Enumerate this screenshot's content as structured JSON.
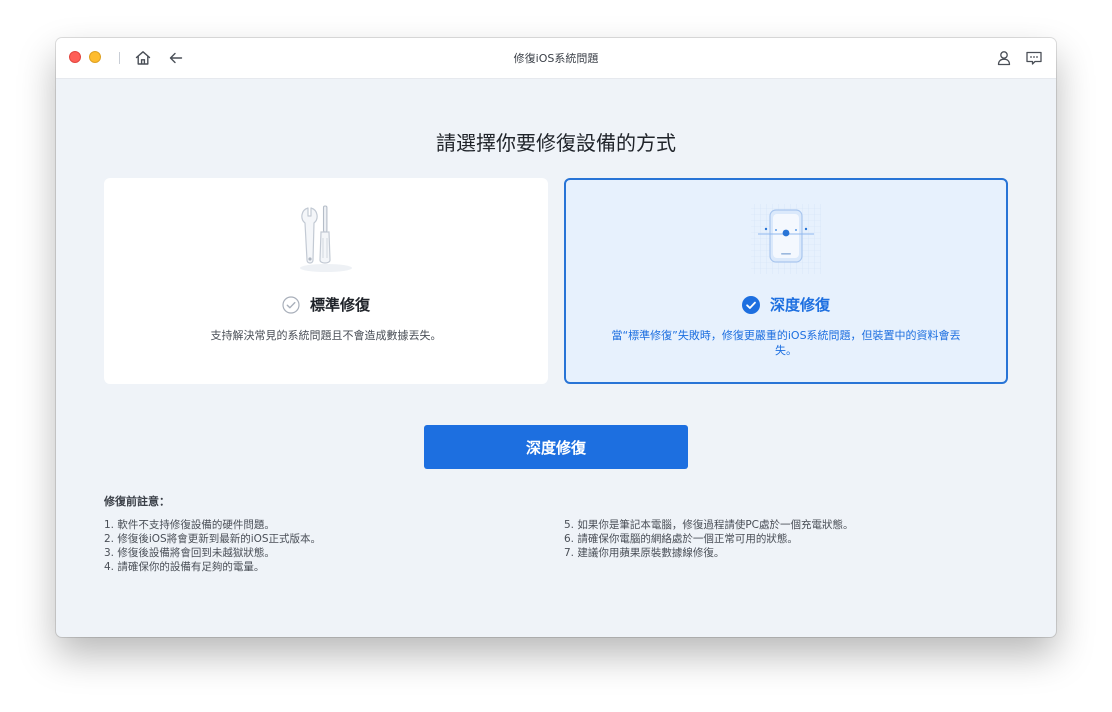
{
  "window": {
    "title": "修復iOS系統問題"
  },
  "page": {
    "heading": "請選擇你要修復設備的方式"
  },
  "modes": [
    {
      "title": "標準修復",
      "description": "支持解決常見的系統問題且不會造成數據丟失。",
      "selected": false,
      "icon": "tools-icon"
    },
    {
      "title": "深度修復",
      "description": "當“標準修復”失敗時，修復更嚴重的iOS系統問題，但裝置中的資料會丟失。",
      "selected": true,
      "icon": "device-icon"
    }
  ],
  "primary_button": {
    "label": "深度修復"
  },
  "notes": {
    "heading": "修復前註意：",
    "left": [
      "1. 軟件不支持修復設備的硬件問題。",
      "2. 修復後iOS將會更新到最新的iOS正式版本。",
      "3. 修復後設備將會回到未越獄狀態。",
      "4. 請確保你的設備有足夠的電量。"
    ],
    "right": [
      "5. 如果你是筆記本電腦，修復過程請使PC處於一個充電狀態。",
      "6. 請確保你電腦的網絡處於一個正常可用的狀態。",
      "7. 建議你用蘋果原裝數據線修復。"
    ]
  },
  "colors": {
    "accent": "#1d6fe0",
    "background": "#eff3f8",
    "selected_card": "#e7f1fd",
    "close": "#fe5f57",
    "minimize": "#febc2e"
  }
}
